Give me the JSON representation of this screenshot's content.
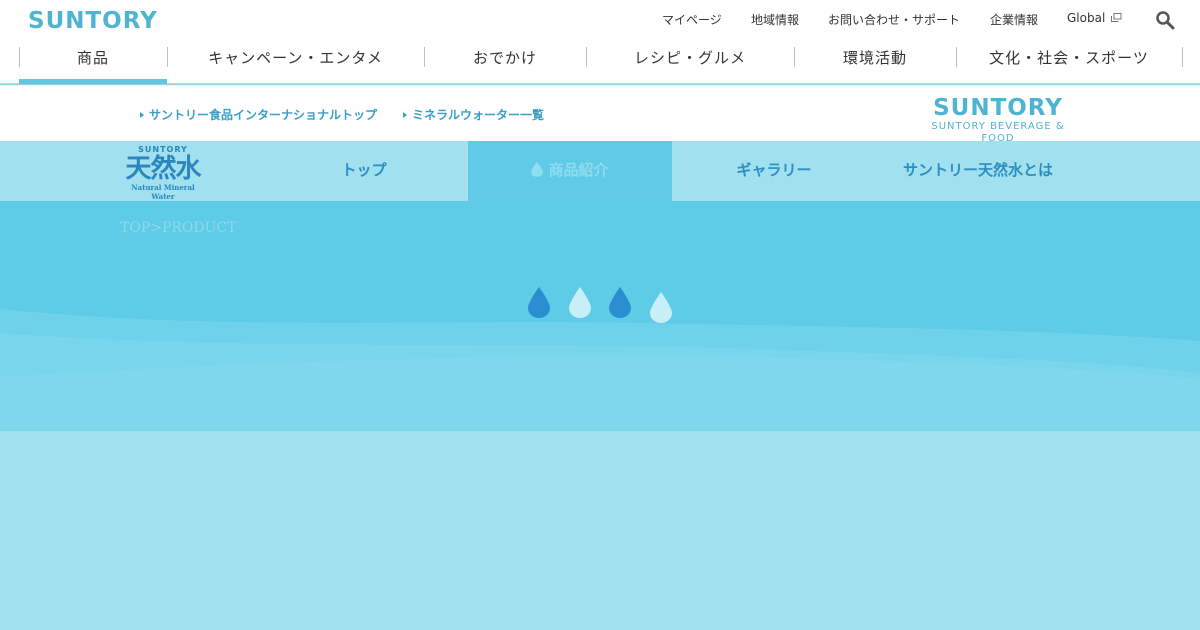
{
  "global_header": {
    "logo": "SUNTORY",
    "utility_links": [
      "マイページ",
      "地域情報",
      "お問い合わせ・サポート",
      "企業情報",
      "Global"
    ],
    "nav": [
      {
        "label": "商品",
        "active": true
      },
      {
        "label": "キャンペーン・エンタメ",
        "active": false
      },
      {
        "label": "おでかけ",
        "active": false
      },
      {
        "label": "レシピ・グルメ",
        "active": false
      },
      {
        "label": "環境活動",
        "active": false
      },
      {
        "label": "文化・社会・スポーツ",
        "active": false
      }
    ]
  },
  "sub_header": {
    "links": [
      "サントリー食品インターナショナルトップ",
      "ミネラルウォーター一覧"
    ],
    "brand_logo": {
      "main": "SUNTORY",
      "sub": "SUNTORY BEVERAGE & FOOD"
    }
  },
  "brand_nav": {
    "logo": {
      "top": "SUNTORY",
      "name": "天然水",
      "caption": "Natural Mineral Water"
    },
    "items": [
      {
        "label": "トップ",
        "active": false
      },
      {
        "label": "商品紹介",
        "active": true
      },
      {
        "label": "ギャラリー",
        "active": false
      },
      {
        "label": "サントリー天然水とは",
        "active": false
      }
    ]
  },
  "hero": {
    "breadcrumb": "TOP>PRODUCT",
    "loader_icons": [
      "water-drop-icon",
      "water-drop-icon",
      "water-drop-icon",
      "water-drop-icon"
    ]
  },
  "colors": {
    "brand_blue": "#4fb3d2",
    "active_underline": "#5fc7e2",
    "hero_bg": "#5ecbe7",
    "page_bg": "#a0e0ef",
    "drop_dark": "#2a8fd1",
    "drop_light": "#c8eef7"
  }
}
